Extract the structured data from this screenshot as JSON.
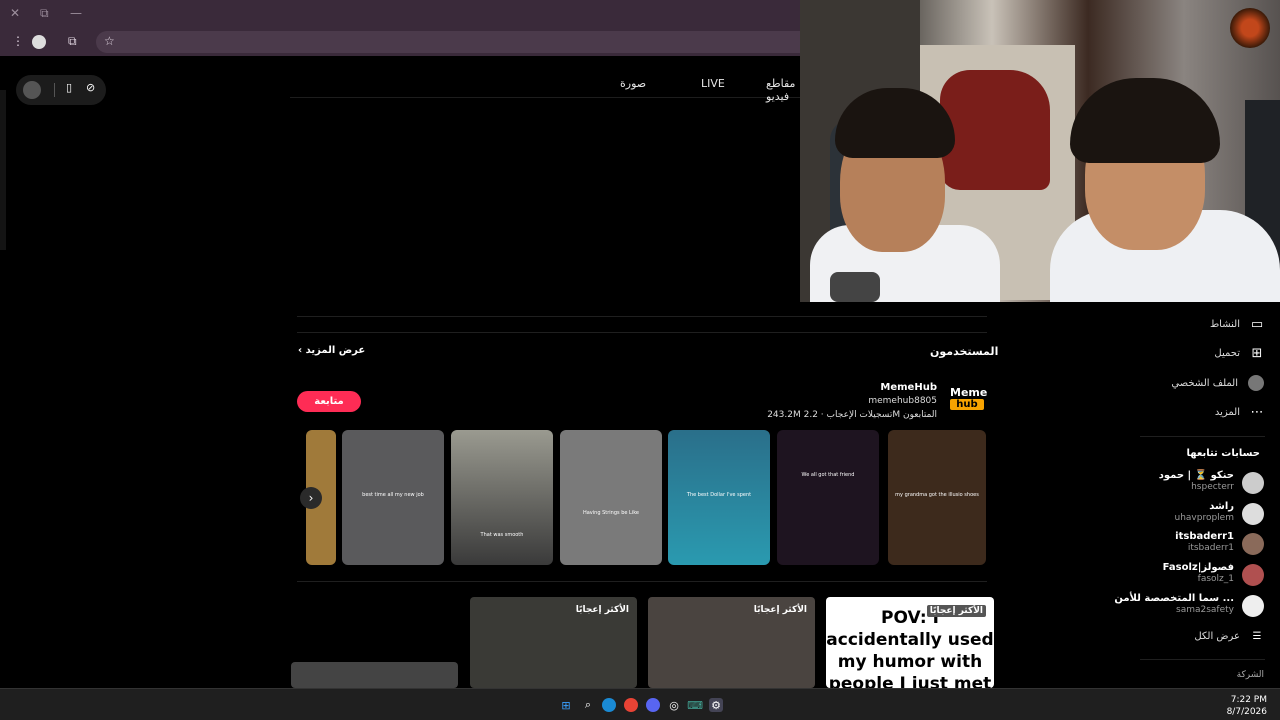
{
  "browser": {
    "window_controls": {
      "close": "✕",
      "restore": "⧉",
      "minimize": "—"
    },
    "toolbar_icons": [
      "menu-dots-icon",
      "avatar",
      "extensions-icon",
      "star-icon"
    ]
  },
  "tabs": {
    "items": [
      "صورة",
      "LIVE",
      "مقاطع فيديو"
    ]
  },
  "sidebar": {
    "items": [
      {
        "label": "النشاط",
        "icon": "message-icon"
      },
      {
        "label": "تحميل",
        "icon": "upload-icon"
      },
      {
        "label": "الملف الشخصي",
        "icon": "profile-icon"
      },
      {
        "label": "المزيد",
        "icon": "more-icon"
      }
    ],
    "following_title": "حسابات تتابعها",
    "accounts": [
      {
        "name": "حنكو ⏳ | حمود",
        "handle": "hspecterr"
      },
      {
        "name": "راشد",
        "handle": "uhavproplem"
      },
      {
        "name": "itsbaderr1",
        "handle": "itsbaderr1"
      },
      {
        "name": "Fasolz|فصولز",
        "handle": "fasolz_1"
      },
      {
        "name": "سما المتخصصة للأمن ...",
        "handle": "sama2safety"
      }
    ],
    "see_all": "عرض الكل",
    "company": "الشركة"
  },
  "users": {
    "heading": "المستخدمون",
    "more": "عرض المزيد",
    "profile": {
      "logo_top": "Meme",
      "logo_bottom": "hub",
      "name": "MemeHub",
      "handle": "memehub8805",
      "followers": "2.2M المتابعون",
      "likes": "243.2M تسجيلات الإعجاب",
      "follow_button": "متابعة"
    },
    "thumbnails": [
      {
        "caption": "my grandma got the illusio shoes",
        "color": "#3d2a1c"
      },
      {
        "caption": "We all got that friend",
        "color": "#1e1420"
      },
      {
        "caption": "The best Dollar I've spent",
        "color": "#2a6f8a"
      },
      {
        "caption": "Having Strings be Like",
        "color": "#7a7a7a"
      },
      {
        "caption": "That was smooth",
        "color": "#8a8a80"
      },
      {
        "caption": "best time all my new job",
        "color": "#5a5a5c"
      },
      {
        "caption": "",
        "color": "#a07a3a"
      }
    ]
  },
  "videos": {
    "badge": "الأكثر إعجابًا",
    "cards": [
      {
        "text": "POV: I accidentally used my humor with people I just met"
      }
    ]
  },
  "clock": {
    "time": "7:22 PM",
    "date": "8/7/2026"
  }
}
